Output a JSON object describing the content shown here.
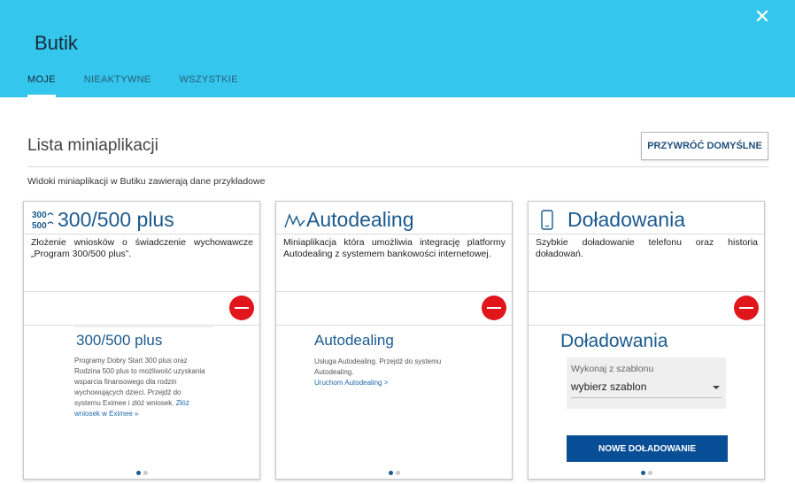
{
  "header": {
    "title": "Butik",
    "close_icon": "close-icon",
    "tabs": [
      {
        "label": "MOJE",
        "active": true
      },
      {
        "label": "NIEAKTYWNE",
        "active": false
      },
      {
        "label": "WSZYSTKIE",
        "active": false
      }
    ]
  },
  "main": {
    "section_title": "Lista miniaplikacji",
    "restore_label": "PRZYWRÓĆ DOMYŚLNE",
    "note": "Widoki miniaplikacji w Butiku zawierają dane przykładowe"
  },
  "cards": [
    {
      "icon": "family-500-icon",
      "title": "300/500 plus",
      "description": "Złożenie wniosków o świadczenie wychowawcze „Program 300/500 plus”.",
      "preview": {
        "title": "300/500 plus",
        "text": "Programy Dobry Start 300 plus oraz Rodzina 500 plus to możliwość uzyskania wsparcia finansowego dla rodzin wychowujących dzieci. Przejdź do systemu Eximee i złóż wniosek.",
        "link": "Złóż wniosek w Eximee »"
      }
    },
    {
      "icon": "autodealing-icon",
      "title": "Autodealing",
      "description": "Miniaplikacja która umożliwia integrację platformy Autodealing z systemem bankowości internetowej.",
      "preview": {
        "title": "Autodealing",
        "text": "Usługa Autodealing. Przejdź do systemu Autodealing.",
        "link": "Uruchom Autodealing >"
      }
    },
    {
      "icon": "mobile-phone-icon",
      "title": "Doładowania",
      "description": "Szybkie doładowanie telefonu oraz historia doładowań.",
      "preview": {
        "title": "Doładowania",
        "template_label": "Wykonaj z szablonu",
        "template_value": "wybierz szablon",
        "button": "NOWE DOŁADOWANIE"
      }
    }
  ],
  "colors": {
    "header_bg": "#34c6ed",
    "accent_blue": "#1b5a8e",
    "remove_red": "#e0161b",
    "button_blue": "#084e96"
  }
}
